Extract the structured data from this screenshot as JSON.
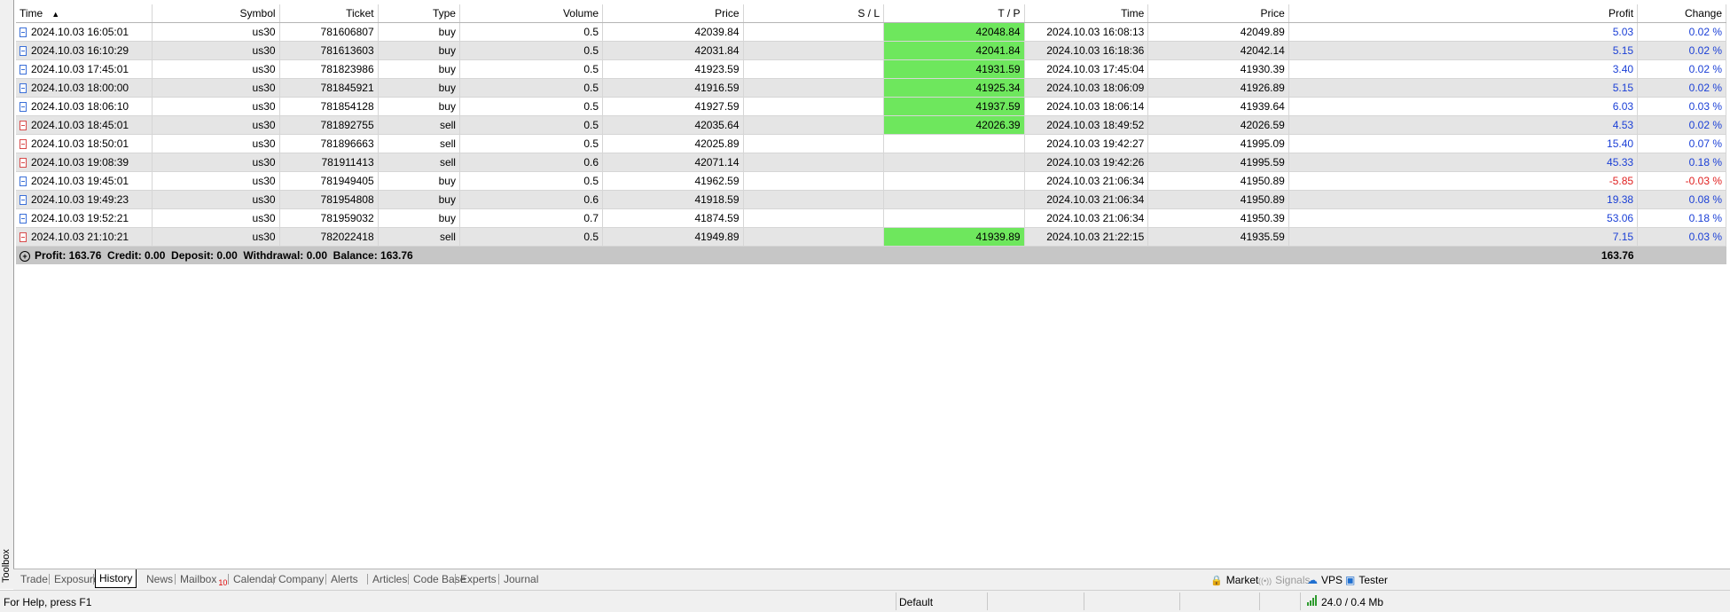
{
  "toolbox": {
    "label": "Toolbox"
  },
  "columns": [
    "Time",
    "Symbol",
    "Ticket",
    "Type",
    "Volume",
    "Price",
    "S / L",
    "T / P",
    "Time",
    "Price",
    "Profit",
    "Change"
  ],
  "sort_indicator": "▲",
  "rows": [
    {
      "open_time": "2024.10.03 16:05:01",
      "symbol": "us30",
      "ticket": "781606807",
      "type": "buy",
      "volume": "0.5",
      "open_price": "42039.84",
      "sl": "",
      "tp": "42048.84",
      "close_time": "2024.10.03 16:08:13",
      "close_price": "42049.89",
      "profit": "5.03",
      "change": "0.02 %"
    },
    {
      "open_time": "2024.10.03 16:10:29",
      "symbol": "us30",
      "ticket": "781613603",
      "type": "buy",
      "volume": "0.5",
      "open_price": "42031.84",
      "sl": "",
      "tp": "42041.84",
      "close_time": "2024.10.03 16:18:36",
      "close_price": "42042.14",
      "profit": "5.15",
      "change": "0.02 %"
    },
    {
      "open_time": "2024.10.03 17:45:01",
      "symbol": "us30",
      "ticket": "781823986",
      "type": "buy",
      "volume": "0.5",
      "open_price": "41923.59",
      "sl": "",
      "tp": "41931.59",
      "close_time": "2024.10.03 17:45:04",
      "close_price": "41930.39",
      "profit": "3.40",
      "change": "0.02 %"
    },
    {
      "open_time": "2024.10.03 18:00:00",
      "symbol": "us30",
      "ticket": "781845921",
      "type": "buy",
      "volume": "0.5",
      "open_price": "41916.59",
      "sl": "",
      "tp": "41925.34",
      "close_time": "2024.10.03 18:06:09",
      "close_price": "41926.89",
      "profit": "5.15",
      "change": "0.02 %"
    },
    {
      "open_time": "2024.10.03 18:06:10",
      "symbol": "us30",
      "ticket": "781854128",
      "type": "buy",
      "volume": "0.5",
      "open_price": "41927.59",
      "sl": "",
      "tp": "41937.59",
      "close_time": "2024.10.03 18:06:14",
      "close_price": "41939.64",
      "profit": "6.03",
      "change": "0.03 %"
    },
    {
      "open_time": "2024.10.03 18:45:01",
      "symbol": "us30",
      "ticket": "781892755",
      "type": "sell",
      "volume": "0.5",
      "open_price": "42035.64",
      "sl": "",
      "tp": "42026.39",
      "close_time": "2024.10.03 18:49:52",
      "close_price": "42026.59",
      "profit": "4.53",
      "change": "0.02 %"
    },
    {
      "open_time": "2024.10.03 18:50:01",
      "symbol": "us30",
      "ticket": "781896663",
      "type": "sell",
      "volume": "0.5",
      "open_price": "42025.89",
      "sl": "",
      "tp": "",
      "close_time": "2024.10.03 19:42:27",
      "close_price": "41995.09",
      "profit": "15.40",
      "change": "0.07 %"
    },
    {
      "open_time": "2024.10.03 19:08:39",
      "symbol": "us30",
      "ticket": "781911413",
      "type": "sell",
      "volume": "0.6",
      "open_price": "42071.14",
      "sl": "",
      "tp": "",
      "close_time": "2024.10.03 19:42:26",
      "close_price": "41995.59",
      "profit": "45.33",
      "change": "0.18 %"
    },
    {
      "open_time": "2024.10.03 19:45:01",
      "symbol": "us30",
      "ticket": "781949405",
      "type": "buy",
      "volume": "0.5",
      "open_price": "41962.59",
      "sl": "",
      "tp": "",
      "close_time": "2024.10.03 21:06:34",
      "close_price": "41950.89",
      "profit": "-5.85",
      "change": "-0.03 %"
    },
    {
      "open_time": "2024.10.03 19:49:23",
      "symbol": "us30",
      "ticket": "781954808",
      "type": "buy",
      "volume": "0.6",
      "open_price": "41918.59",
      "sl": "",
      "tp": "",
      "close_time": "2024.10.03 21:06:34",
      "close_price": "41950.89",
      "profit": "19.38",
      "change": "0.08 %"
    },
    {
      "open_time": "2024.10.03 19:52:21",
      "symbol": "us30",
      "ticket": "781959032",
      "type": "buy",
      "volume": "0.7",
      "open_price": "41874.59",
      "sl": "",
      "tp": "",
      "close_time": "2024.10.03 21:06:34",
      "close_price": "41950.39",
      "profit": "53.06",
      "change": "0.18 %"
    },
    {
      "open_time": "2024.10.03 21:10:21",
      "symbol": "us30",
      "ticket": "782022418",
      "type": "sell",
      "volume": "0.5",
      "open_price": "41949.89",
      "sl": "",
      "tp": "41939.89",
      "close_time": "2024.10.03 21:22:15",
      "close_price": "41935.59",
      "profit": "7.15",
      "change": "0.03 %"
    }
  ],
  "summary": {
    "text": "Profit: 163.76  Credit: 0.00  Deposit: 0.00  Withdrawal: 0.00  Balance: 163.76",
    "total_profit": "163.76"
  },
  "tabs": [
    {
      "label": "Trade"
    },
    {
      "label": "Exposure"
    },
    {
      "label": "History"
    },
    {
      "label": "News"
    },
    {
      "label": "Mailbox"
    },
    {
      "label": "Calendar"
    },
    {
      "label": "Company"
    },
    {
      "label": "Alerts"
    },
    {
      "label": "Articles"
    },
    {
      "label": "Code Base"
    },
    {
      "label": "Experts"
    },
    {
      "label": "Journal"
    }
  ],
  "active_tab": "History",
  "mailbox_badge": "10",
  "right_buttons": {
    "market": "Market",
    "signals": "Signals",
    "vps": "VPS",
    "tester": "Tester"
  },
  "status": {
    "help": "For Help, press F1",
    "profile": "Default",
    "connection": "24.0 / 0.4 Mb"
  },
  "colors": {
    "tp_highlight": "#6ee75d",
    "profit_positive": "#1a3fd6",
    "profit_negative": "#e02020",
    "summary_bg": "#c6c6c6"
  }
}
